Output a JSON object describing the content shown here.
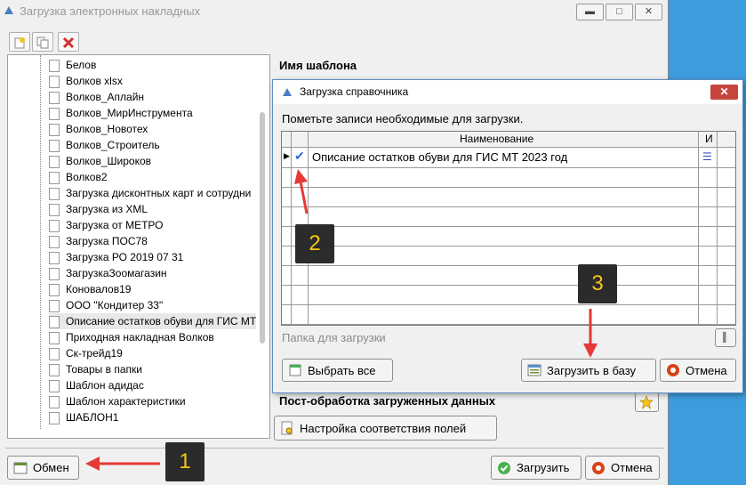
{
  "main_window": {
    "title": "Загрузка электронных накладных",
    "template_name_label": "Имя шаблона",
    "postprocess_label": "Пост-обработка загруженных данных",
    "field_mapping_button": "Настройка соответствия полей",
    "exchange_button": "Обмен",
    "load_button": "Загрузить",
    "cancel_button": "Отмена",
    "tree_items": [
      "Белов",
      "Волков xlsx",
      "Волков_Аплайн",
      "Волков_МирИнструмента",
      "Волков_Новотех",
      "Волков_Строитель",
      "Волков_Широков",
      "Волков2",
      "Загрузка дисконтных карт и сотрудни",
      "Загрузка из XML",
      "Загрузка от МЕТРО",
      "Загрузка ПОС78",
      "Загрузка РО 2019 07 31",
      "ЗагрузкаЗоомагазин",
      "Коновалов19",
      "ООО \"Кондитер 33\"",
      "Описание остатков обуви для ГИС МТ",
      "Приходная накладная Волков",
      "Ск-трейд19",
      "Товары в папки",
      "Шаблон адидас",
      "Шаблон характеристики",
      "ШАБЛОН1"
    ]
  },
  "dialog": {
    "title": "Загрузка справочника",
    "instruction": "Пометьте записи необходимые для загрузки.",
    "columns": {
      "name": "Наименование",
      "extra": "И"
    },
    "rows": [
      {
        "name": "Описание остатков обуви для ГИС МТ 2023 год",
        "checked": true
      }
    ],
    "folder_label": "Папка для загрузки",
    "select_all_button": "Выбрать все",
    "load_to_db_button": "Загрузить в базу",
    "cancel_button": "Отмена"
  },
  "annotations": {
    "badge1": "1",
    "badge2": "2",
    "badge3": "3"
  },
  "colors": {
    "annotation_arrow": "#e53935",
    "badge_bg": "#2b2b2b",
    "badge_text": "#f5c518",
    "desktop": "#3d9cde"
  }
}
